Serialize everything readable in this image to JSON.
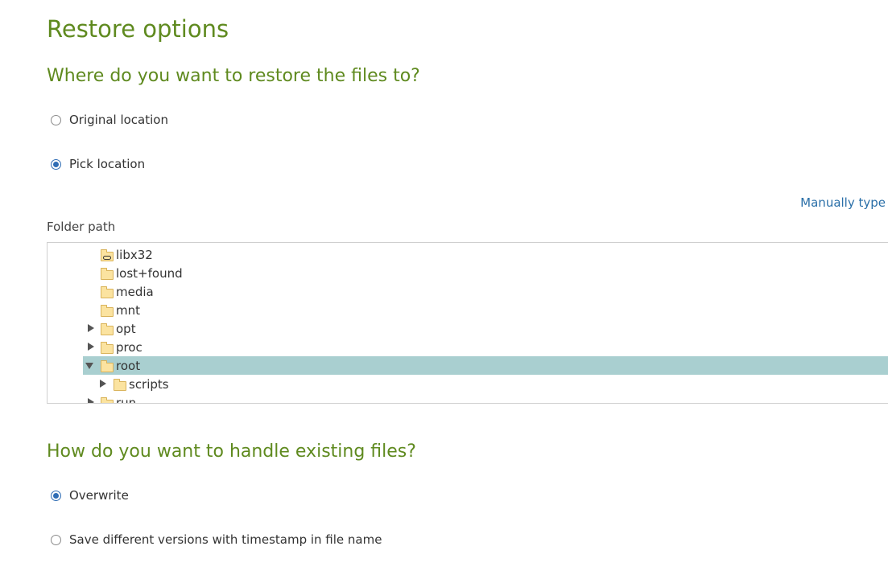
{
  "page": {
    "title": "Restore options"
  },
  "restore_location": {
    "heading": "Where do you want to restore the files to?",
    "options": [
      {
        "label": "Original location",
        "selected": false
      },
      {
        "label": "Pick location",
        "selected": true
      }
    ],
    "manual_link": "Manually type",
    "folder_path_label": "Folder path"
  },
  "tree": {
    "nodes": [
      {
        "label": "libx32",
        "expandable": false,
        "symlink": true
      },
      {
        "label": "lost+found",
        "expandable": false
      },
      {
        "label": "media",
        "expandable": false
      },
      {
        "label": "mnt",
        "expandable": false
      },
      {
        "label": "opt",
        "expandable": true,
        "expanded": false
      },
      {
        "label": "proc",
        "expandable": true,
        "expanded": false
      },
      {
        "label": "root",
        "expandable": true,
        "expanded": true,
        "selected": true
      },
      {
        "label": "scripts",
        "expandable": true,
        "expanded": false,
        "child": true
      },
      {
        "label": "run",
        "expandable": true,
        "expanded": false
      }
    ]
  },
  "existing_files": {
    "heading": "How do you want to handle existing files?",
    "options": [
      {
        "label": "Overwrite",
        "selected": true
      },
      {
        "label": "Save different versions with timestamp in file name",
        "selected": false
      }
    ]
  },
  "colors": {
    "heading": "#5f8a1f",
    "link": "#2a6fa8",
    "radio_selected": "#2f6db5",
    "selection": "#a9cfd0",
    "folder": "#fbe3a0"
  }
}
